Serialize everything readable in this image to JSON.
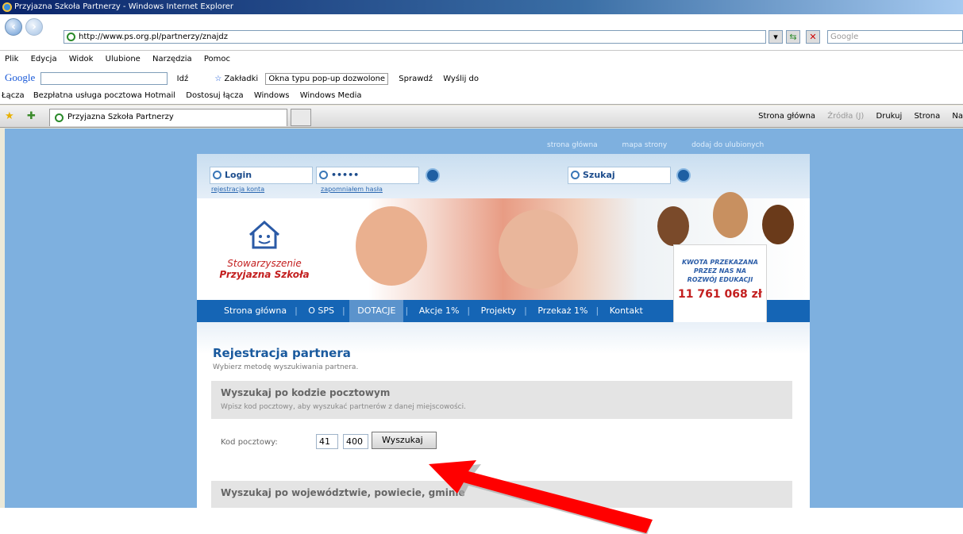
{
  "window": {
    "title": "Przyjazna Szkoła Partnerzy - Windows Internet Explorer"
  },
  "address": {
    "url": "http://www.ps.org.pl/partnerzy/znajdz",
    "search_placeholder": "Google"
  },
  "menu": [
    "Plik",
    "Edycja",
    "Widok",
    "Ulubione",
    "Narzędzia",
    "Pomoc"
  ],
  "google_toolbar": {
    "logo": "Google",
    "go": "Idź",
    "bookmarks": "Zakładki",
    "popups": "Okna typu pop-up dozwolone",
    "check": "Sprawdź",
    "send": "Wyślij do"
  },
  "links_bar": {
    "label": "Łącza",
    "items": [
      "Bezpłatna usługa pocztowa Hotmail",
      "Dostosuj łącza",
      "Windows",
      "Windows Media"
    ]
  },
  "tab": {
    "title": "Przyjazna Szkoła Partnerzy"
  },
  "tab_tools": [
    "Strona główna",
    "Źródła (J)",
    "Drukuj",
    "Strona",
    "Na"
  ],
  "site": {
    "top_links": [
      "strona główna",
      "mapa strony",
      "dodaj do ulubionych"
    ],
    "login_label": "Login",
    "password_value": "•••••",
    "search_label": "Szukaj",
    "register_link": "rejestracja konta",
    "forgot_link": "zapomniałem hasła",
    "logo_line1": "Stowarzyszenie",
    "logo_line2": "Przyjazna Szkoła",
    "nav": [
      "Strona główna",
      "O SPS",
      "DOTACJE",
      "Akcje 1%",
      "Projekty",
      "Przekaż 1%",
      "Kontakt"
    ],
    "kwota_lines": [
      "KWOTA PRZEKAZANA",
      "PRZEZ NAS NA",
      "ROZWÓJ EDUKACJI"
    ],
    "kwota_amount": "11 761 068 zł",
    "page_title": "Rejestracja partnera",
    "page_subtitle": "Wybierz metodę wyszukiwania partnera.",
    "section1_title": "Wyszukaj po kodzie pocztowym",
    "section1_desc": "Wpisz kod pocztowy, aby wyszukać partnerów z danej miejscowości.",
    "kod_label": "Kod pocztowy:",
    "kod_part1": "41",
    "kod_part2": "400",
    "search_button": "Wyszukaj",
    "section2_title": "Wyszukaj po województwie, powiecie, gminie"
  },
  "colors": {
    "accent": "#1565b5",
    "arrow": "#ff0000",
    "amount": "#c31f1f"
  }
}
